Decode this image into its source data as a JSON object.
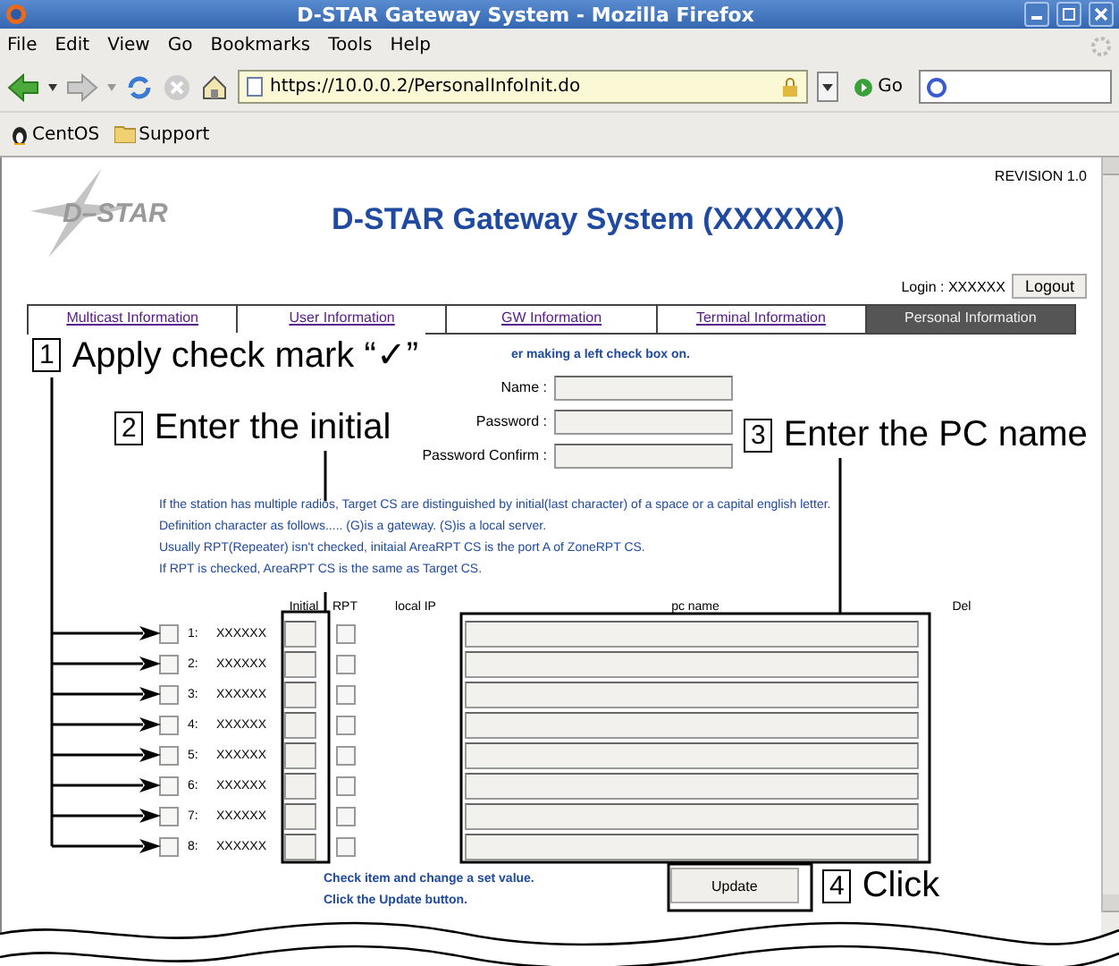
{
  "window": {
    "title": "D-STAR Gateway System - Mozilla Firefox"
  },
  "menu": [
    "File",
    "Edit",
    "View",
    "Go",
    "Bookmarks",
    "Tools",
    "Help"
  ],
  "address_bar": {
    "value": "https://10.0.0.2/PersonalInfoInit.do"
  },
  "go_label": "Go",
  "bookmarks": [
    "CentOS",
    "Support"
  ],
  "page": {
    "logo_text": "D–STAR",
    "title": "D-STAR Gateway System (XXXXXX)",
    "revision": "REVISION 1.0",
    "login": "Login : XXXXXX",
    "logout": "Logout"
  },
  "tabs": [
    {
      "label": "Multicast Information",
      "selected": false
    },
    {
      "label": "User Information",
      "selected": false
    },
    {
      "label": "GW Information",
      "selected": false
    },
    {
      "label": "Terminal Information",
      "selected": false
    },
    {
      "label": "Personal Information",
      "selected": true
    }
  ],
  "instruction": "er making a left check box on.",
  "fields": [
    {
      "label": "Name :"
    },
    {
      "label": "Password :"
    },
    {
      "label": "Password Confirm :"
    }
  ],
  "notes": [
    "If the station has multiple radios, Target CS are distinguished by initial(last character) of a space or a capital english letter.",
    "Definition character as follows..... (G)is a gateway. (S)is a local server.",
    "Usually RPT(Repeater) isn't checked, initaial AreaRPT CS is the port A of ZoneRPT CS.",
    "If RPT is checked, AreaRPT CS is the same as Target CS."
  ],
  "table": {
    "columns": [
      "Initial",
      "RPT",
      "local IP",
      "pc name",
      "Del"
    ],
    "rows": [
      {
        "number": "1:",
        "callsign": "XXXXXX",
        "checked": false,
        "rpt": false
      },
      {
        "number": "2:",
        "callsign": "XXXXXX",
        "checked": false,
        "rpt": false
      },
      {
        "number": "3:",
        "callsign": "XXXXXX",
        "checked": false,
        "rpt": false
      },
      {
        "number": "4:",
        "callsign": "XXXXXX",
        "checked": false,
        "rpt": false
      },
      {
        "number": "5:",
        "callsign": "XXXXXX",
        "checked": false,
        "rpt": false
      },
      {
        "number": "6:",
        "callsign": "XXXXXX",
        "checked": false,
        "rpt": false
      },
      {
        "number": "7:",
        "callsign": "XXXXXX",
        "checked": false,
        "rpt": false
      },
      {
        "number": "8:",
        "callsign": "XXXXXX",
        "checked": false,
        "rpt": false
      }
    ]
  },
  "footer_notes": [
    "Check item and change a set value.",
    "Click the Update button."
  ],
  "update_button": "Update",
  "callouts": [
    {
      "number": "1",
      "text": "Apply check mark “✓”"
    },
    {
      "number": "2",
      "text": "Enter the initial"
    },
    {
      "number": "3",
      "text": "Enter the PC name"
    },
    {
      "number": "4",
      "text": "Click"
    }
  ]
}
